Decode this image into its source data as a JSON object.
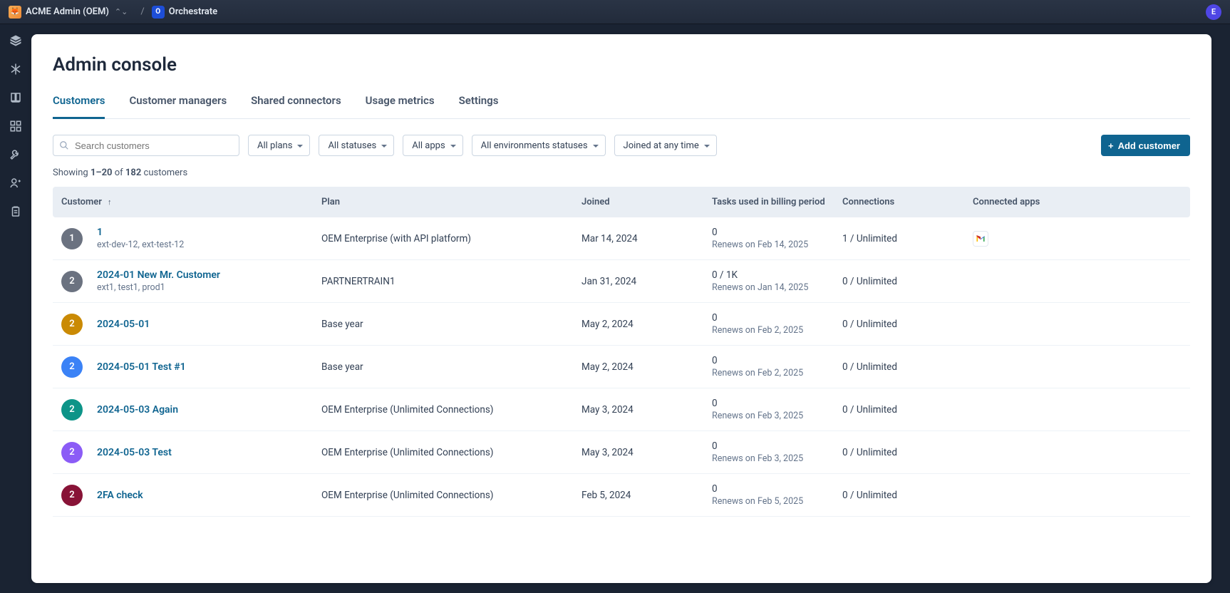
{
  "topbar": {
    "account_name": "ACME Admin (OEM)",
    "app_name": "Orchestrate",
    "avatar_letter": "E"
  },
  "page": {
    "title": "Admin console"
  },
  "tabs": [
    {
      "label": "Customers",
      "active": true
    },
    {
      "label": "Customer managers",
      "active": false
    },
    {
      "label": "Shared connectors",
      "active": false
    },
    {
      "label": "Usage metrics",
      "active": false
    },
    {
      "label": "Settings",
      "active": false
    }
  ],
  "search": {
    "placeholder": "Search customers"
  },
  "filters": [
    {
      "label": "All plans"
    },
    {
      "label": "All statuses"
    },
    {
      "label": "All apps"
    },
    {
      "label": "All environments statuses"
    },
    {
      "label": "Joined at any time"
    }
  ],
  "add_button_label": "Add customer",
  "showing": {
    "prefix": "Showing ",
    "range": "1–20",
    "of": " of ",
    "total": "182",
    "suffix": " customers"
  },
  "columns": {
    "customer": "Customer",
    "plan": "Plan",
    "joined": "Joined",
    "tasks": "Tasks used in billing period",
    "connections": "Connections",
    "apps": "Connected apps"
  },
  "rows": [
    {
      "avatar": "1",
      "avatar_bg": "#6b7280",
      "name": "1",
      "sub": "ext-dev-12, ext-test-12",
      "plan": "OEM Enterprise (with API platform)",
      "joined": "Mar 14, 2024",
      "tasks": "0",
      "tasks_sub": "Renews on Feb 14, 2025",
      "connections": "1 / Unlimited",
      "apps": "gmail"
    },
    {
      "avatar": "2",
      "avatar_bg": "#6b7280",
      "name": "2024-01 New Mr. Customer",
      "sub": "ext1, test1, prod1",
      "plan": "PARTNERTRAIN1",
      "joined": "Jan 31, 2024",
      "tasks": "0 / 1K",
      "tasks_sub": "Renews on Jan 14, 2025",
      "connections": "0 / Unlimited",
      "apps": ""
    },
    {
      "avatar": "2",
      "avatar_bg": "#ca8a04",
      "name": "2024-05-01",
      "sub": "",
      "plan": "Base year",
      "joined": "May 2, 2024",
      "tasks": "0",
      "tasks_sub": "Renews on Feb 2, 2025",
      "connections": "0 / Unlimited",
      "apps": ""
    },
    {
      "avatar": "2",
      "avatar_bg": "#3b82f6",
      "name": "2024-05-01 Test #1",
      "sub": "",
      "plan": "Base year",
      "joined": "May 2, 2024",
      "tasks": "0",
      "tasks_sub": "Renews on Feb 2, 2025",
      "connections": "0 / Unlimited",
      "apps": ""
    },
    {
      "avatar": "2",
      "avatar_bg": "#0d9488",
      "name": "2024-05-03 Again",
      "sub": "",
      "plan": "OEM Enterprise (Unlimited Connections)",
      "joined": "May 3, 2024",
      "tasks": "0",
      "tasks_sub": "Renews on Feb 3, 2025",
      "connections": "0 / Unlimited",
      "apps": ""
    },
    {
      "avatar": "2",
      "avatar_bg": "#8b5cf6",
      "name": "2024-05-03 Test",
      "sub": "",
      "plan": "OEM Enterprise (Unlimited Connections)",
      "joined": "May 3, 2024",
      "tasks": "0",
      "tasks_sub": "Renews on Feb 3, 2025",
      "connections": "0 / Unlimited",
      "apps": ""
    },
    {
      "avatar": "2",
      "avatar_bg": "#881337",
      "name": "2FA check",
      "sub": "",
      "plan": "OEM Enterprise (Unlimited Connections)",
      "joined": "Feb 5, 2024",
      "tasks": "0",
      "tasks_sub": "Renews on Feb 5, 2025",
      "connections": "0 / Unlimited",
      "apps": ""
    }
  ]
}
